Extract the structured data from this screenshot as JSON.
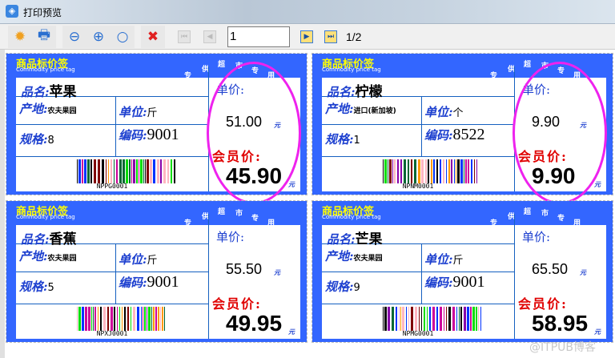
{
  "window": {
    "title": "打印预览"
  },
  "toolbar": {
    "page_value": "1",
    "page_count": "1/2"
  },
  "labels": [
    {
      "title": "商品标价签",
      "subtitle": "Commodity price tag",
      "slogan": [
        "专",
        "供",
        "超",
        "市",
        "专",
        "用"
      ],
      "name_label": "品名:",
      "name": "苹果",
      "origin_label": "产地:",
      "origin": "农夫果园",
      "unit_label": "单位:",
      "unit": "斤",
      "spec_label": "规格:",
      "spec": "8",
      "code_label": "编码:",
      "code": "9001",
      "barcode": "NPPG0001",
      "price_label": "单价:",
      "price": "51.00",
      "currency": "元",
      "member_label": "会员价:",
      "member_price": "45.90",
      "circled": true
    },
    {
      "title": "商品标价签",
      "subtitle": "Commodity price tag",
      "slogan": [
        "专",
        "供",
        "超",
        "市",
        "专",
        "用"
      ],
      "name_label": "品名:",
      "name": "柠檬",
      "origin_label": "产地:",
      "origin": "进口(新加坡)",
      "unit_label": "单位:",
      "unit": "个",
      "spec_label": "规格:",
      "spec": "1",
      "code_label": "编码:",
      "code": "8522",
      "barcode": "NPNM0001",
      "price_label": "单价:",
      "price": "9.90",
      "currency": "元",
      "member_label": "会员价:",
      "member_price": "9.90",
      "circled": true
    },
    {
      "title": "商品标价签",
      "subtitle": "Commodity price tag",
      "slogan": [
        "专",
        "供",
        "超",
        "市",
        "专",
        "用"
      ],
      "name_label": "品名:",
      "name": "香蕉",
      "origin_label": "产地:",
      "origin": "农夫果园",
      "unit_label": "单位:",
      "unit": "斤",
      "spec_label": "规格:",
      "spec": "5",
      "code_label": "编码:",
      "code": "9001",
      "barcode": "NPXJ0001",
      "price_label": "单价:",
      "price": "55.50",
      "currency": "元",
      "member_label": "会员价:",
      "member_price": "49.95",
      "circled": false
    },
    {
      "title": "商品标价签",
      "subtitle": "Commodity price tag",
      "slogan": [
        "专",
        "供",
        "超",
        "市",
        "专",
        "用"
      ],
      "name_label": "品名:",
      "name": "芒果",
      "origin_label": "产地:",
      "origin": "农夫果园",
      "unit_label": "单位:",
      "unit": "斤",
      "spec_label": "规格:",
      "spec": "9",
      "code_label": "编码:",
      "code": "9001",
      "barcode": "NPMG0001",
      "price_label": "单价:",
      "price": "65.50",
      "currency": "元",
      "member_label": "会员价:",
      "member_price": "58.95",
      "circled": false
    }
  ],
  "watermark": "@ITPUB博客",
  "colors": {
    "label_bg": "#3366ff",
    "circle": "#ee22ee",
    "member": "#e00000"
  }
}
